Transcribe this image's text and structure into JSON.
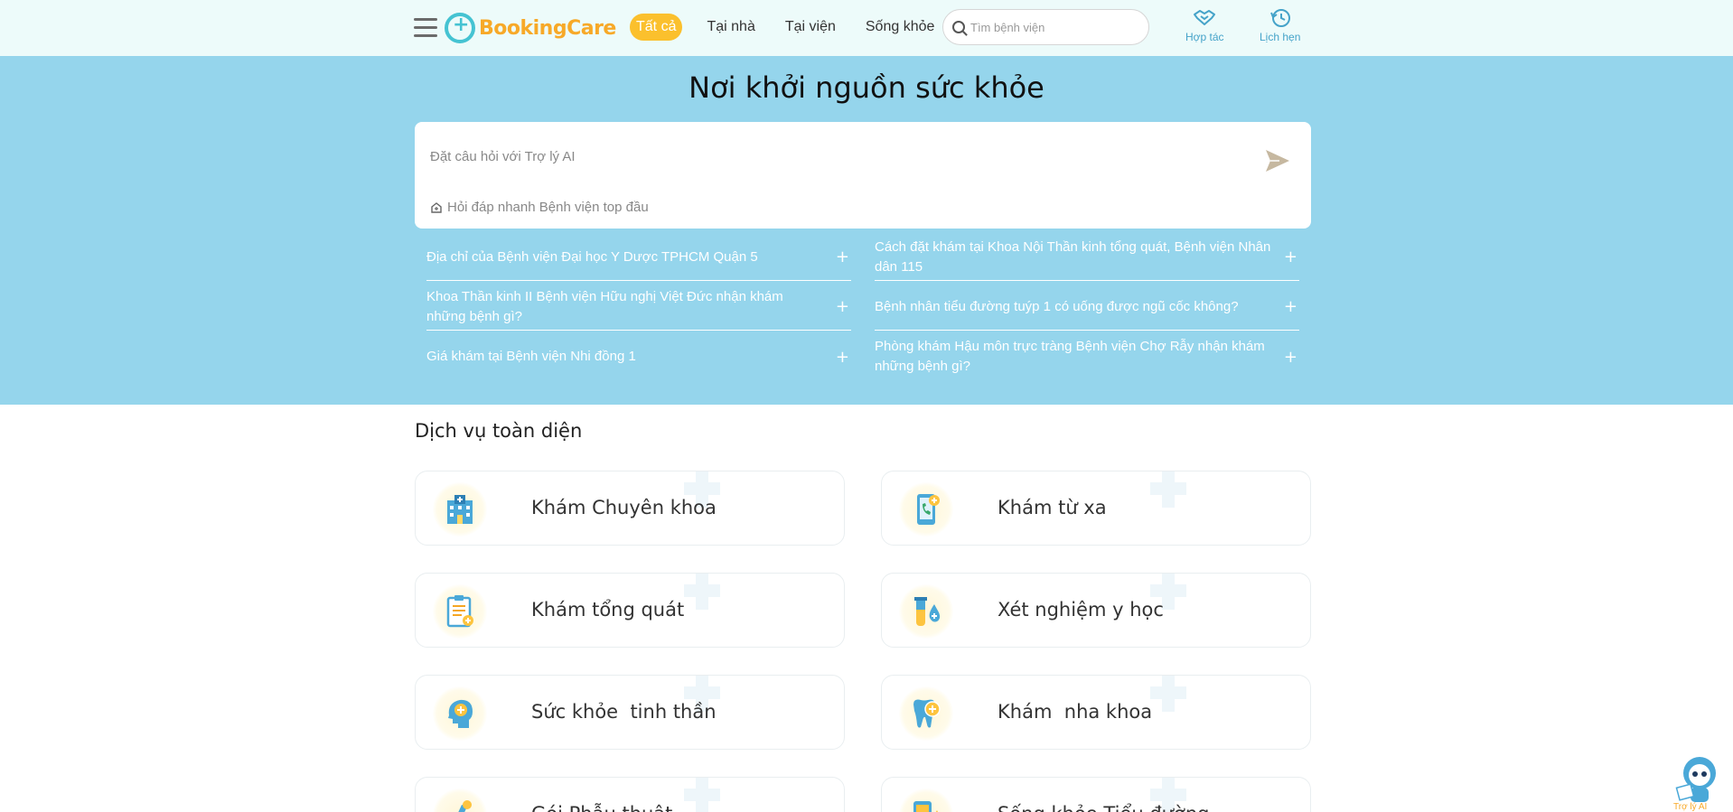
{
  "header": {
    "logo_text": "BookingCare",
    "nav": [
      {
        "label": "Tất cả",
        "active": true
      },
      {
        "label": "Tại nhà",
        "active": false
      },
      {
        "label": "Tại viện",
        "active": false
      },
      {
        "label": "Sống khỏe",
        "active": false
      }
    ],
    "search_placeholder": "Tìm bệnh viện",
    "actions": [
      {
        "label": "Hợp tác",
        "icon": "handshake-icon"
      },
      {
        "label": "Lịch hẹn",
        "icon": "history-icon"
      }
    ]
  },
  "hero": {
    "title": "Nơi khởi nguồn sức khỏe",
    "ai_placeholder": "Đặt câu hỏi với Trợ lý AI",
    "quick_link": "Hỏi đáp nhanh Bệnh viện top đầu",
    "faqs": [
      "Địa chỉ của Bệnh viện Đại học Y Dược TPHCM Quận 5",
      "Cách đặt khám tại Khoa Nội Thần kinh tổng quát, Bệnh viện Nhân dân 115",
      "Khoa Thần kinh II Bệnh viện Hữu nghị Việt Đức nhận khám những bệnh gì?",
      "Bệnh nhân tiểu đường tuýp 1 có uống được ngũ cốc không?",
      "Giá khám tại Bệnh viện Nhi đồng 1",
      "Phòng khám Hậu môn trực tràng Bệnh viện Chợ Rẫy nhận khám những bệnh gì?"
    ],
    "faq_toggle": "+"
  },
  "services": {
    "title": "Dịch vụ toàn diện",
    "items": [
      {
        "label": "Khám Chuyên khoa",
        "icon": "hospital-icon"
      },
      {
        "label": "Khám từ xa",
        "icon": "phone-call-icon"
      },
      {
        "label": "Khám tổng quát",
        "icon": "clipboard-icon"
      },
      {
        "label": "Xét nghiệm y học",
        "icon": "test-tube-icon"
      },
      {
        "label": "Sức khỏe  tinh thần",
        "icon": "mental-health-icon"
      },
      {
        "label": "Khám  nha khoa",
        "icon": "tooth-icon"
      },
      {
        "label": "Gói Phẫu thuật",
        "icon": "surgery-icon"
      },
      {
        "label": "Sống khỏe Tiểu đường",
        "icon": "diabetes-icon"
      }
    ]
  },
  "assistant": {
    "label": "Trợ lý AI"
  },
  "colors": {
    "accent": "#fbc02d",
    "hero_bg": "#95d5ec",
    "header_bg": "#edfbfa",
    "brand_blue": "#45c3d2",
    "brand_orange": "#f7a928"
  }
}
